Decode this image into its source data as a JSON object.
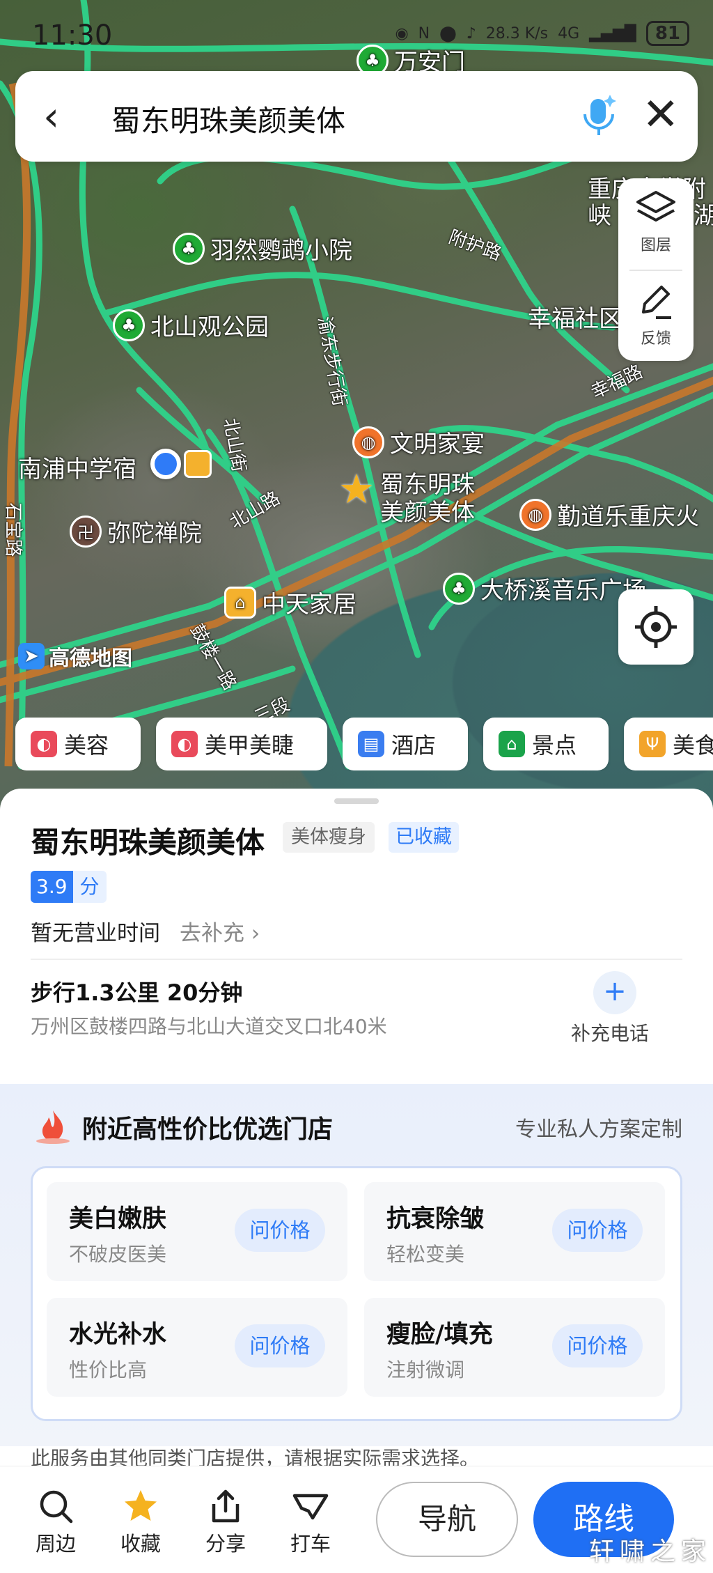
{
  "status_bar": {
    "time": "11:30",
    "net_speed": "28.3 K/s",
    "network": "4G",
    "battery": "81"
  },
  "search": {
    "query": "蜀东明珠美颜美体"
  },
  "map_controls": {
    "layers_label": "图层",
    "feedback_label": "反馈"
  },
  "map": {
    "pois": [
      "万安门",
      "羽然鹦鹉小院",
      "北山观公园",
      "幸福社区",
      "文明家宴",
      "南浦中学宿",
      "蜀东明珠\n美颜美体",
      "弥陀禅院",
      "勤道乐重庆火",
      "大桥溪音乐广场",
      "中天家居",
      "重庆大学附",
      "峡",
      "湖"
    ],
    "roads": [
      "附护路",
      "渝东步行街",
      "北山街",
      "北山路",
      "鼓楼一路",
      "石宝路",
      "幸福路",
      "三段"
    ],
    "brand": "高德地图"
  },
  "categories": [
    {
      "label": "美容",
      "color": "#e94a5b"
    },
    {
      "label": "美甲美睫",
      "color": "#e94a5b"
    },
    {
      "label": "酒店",
      "color": "#3a7df0"
    },
    {
      "label": "景点",
      "color": "#1aa34a"
    },
    {
      "label": "美食",
      "color": "#f2a42a"
    }
  ],
  "place": {
    "name": "蜀东明珠美颜美体",
    "category_tag": "美体瘦身",
    "fav_tag": "已收藏",
    "rating": "3.9",
    "rating_unit": "分",
    "hours": "暂无营业时间",
    "hours_add": "去补充",
    "walk": "步行1.3公里 20分钟",
    "address": "万州区鼓楼四路与北山大道交叉口北40米",
    "phone_label": "补充电话"
  },
  "promo": {
    "title": "附近高性价比优选门店",
    "link": "专业私人方案定制",
    "services": [
      {
        "name": "美白嫩肤",
        "desc": "不破皮医美",
        "action": "问价格"
      },
      {
        "name": "抗衰除皱",
        "desc": "轻松变美",
        "action": "问价格"
      },
      {
        "name": "水光补水",
        "desc": "性价比高",
        "action": "问价格"
      },
      {
        "name": "瘦脸/填充",
        "desc": "注射微调",
        "action": "问价格"
      }
    ],
    "disclaimer": "此服务由其他同类门店提供，请根据实际需求选择。"
  },
  "bottom_bar": {
    "nearby": "周边",
    "favorite": "收藏",
    "share": "分享",
    "taxi": "打车",
    "navigate": "导航",
    "route": "路线"
  },
  "watermark": "轩啸之家",
  "accent_color": "#1f6ff4"
}
